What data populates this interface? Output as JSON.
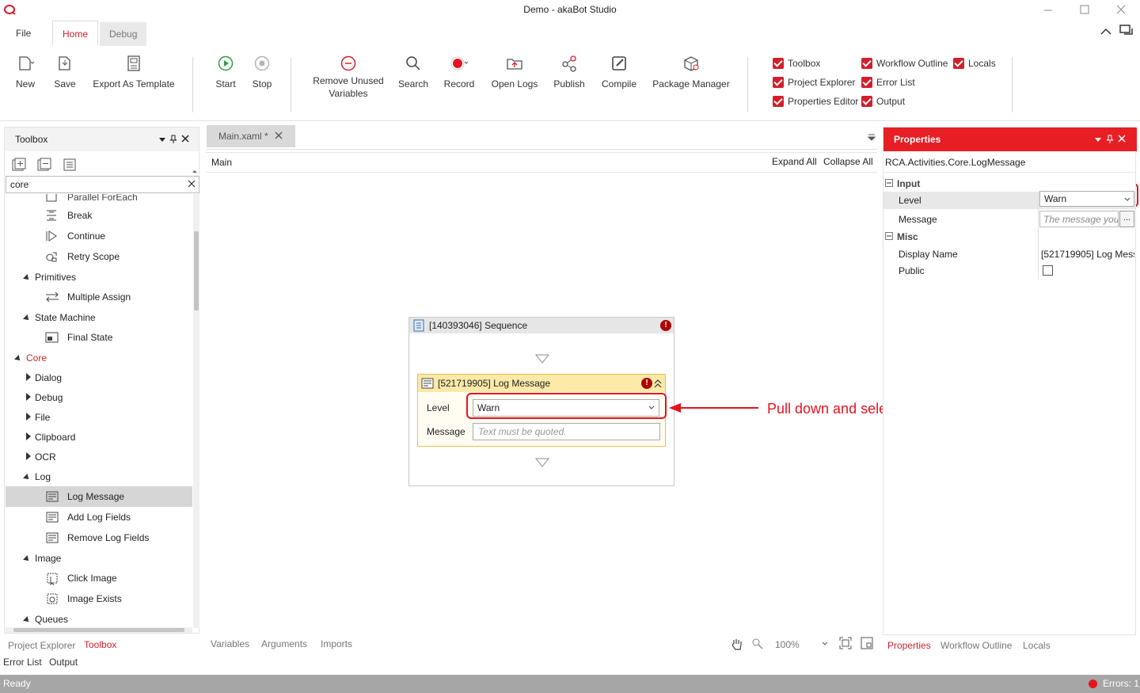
{
  "window": {
    "title": "Demo - akaBot Studio"
  },
  "ribbon_tabs": [
    "File",
    "Home",
    "Debug"
  ],
  "ribbon": {
    "new": "New",
    "save": "Save",
    "export_template": "Export As Template",
    "start": "Start",
    "stop": "Stop",
    "remove_unused_1": "Remove Unused",
    "remove_unused_2": "Variables",
    "search": "Search",
    "record": "Record",
    "open_logs": "Open Logs",
    "publish": "Publish",
    "compile": "Compile",
    "package_manager": "Package Manager"
  },
  "view_toggles": {
    "toolbox": "Toolbox",
    "project_explorer": "Project Explorer",
    "properties_editor": "Properties Editor",
    "workflow_outline": "Workflow Outline",
    "error_list": "Error List",
    "output": "Output",
    "locals": "Locals"
  },
  "toolbox": {
    "title": "Toolbox",
    "search_value": "core",
    "partial_item": "Parallel ForEach",
    "items": {
      "break": "Break",
      "continue": "Continue",
      "retry_scope": "Retry Scope",
      "primitives": "Primitives",
      "multiple_assign": "Multiple Assign",
      "state_machine": "State Machine",
      "final_state": "Final State",
      "core": "Core",
      "dialog": "Dialog",
      "debug": "Debug",
      "file": "File",
      "clipboard": "Clipboard",
      "ocr": "OCR",
      "log": "Log",
      "log_message": "Log Message",
      "add_log_fields": "Add Log Fields",
      "remove_log_fields": "Remove Log Fields",
      "image": "Image",
      "click_image": "Click Image",
      "image_exists": "Image Exists",
      "queues": "Queues"
    }
  },
  "document": {
    "tab": "Main.xaml *",
    "breadcrumb": "Main",
    "expand_all": "Expand All",
    "collapse_all": "Collapse All"
  },
  "sequence": {
    "title": "[140393046] Sequence",
    "activity": {
      "title": "[521719905] Log Message",
      "level_label": "Level",
      "level_value": "Warn",
      "message_label": "Message",
      "message_placeholder": "Text must be quoted."
    }
  },
  "annotation": {
    "text": "Pull down and select",
    "color": "#e3141e"
  },
  "properties": {
    "title": "Properties",
    "type": "RCA.Activities.Core.LogMessage",
    "input_section": "Input",
    "level_label": "Level",
    "level_value": "Warn",
    "message_label": "Message",
    "message_placeholder": "The message you",
    "misc_section": "Misc",
    "display_name_label": "Display Name",
    "display_name_value": "[521719905] Log Mess",
    "public_label": "Public",
    "ellipsis": "..."
  },
  "bottom_left_tabs": [
    "Project Explorer",
    "Toolbox",
    "Error List",
    "Output"
  ],
  "designer_footer": {
    "variables": "Variables",
    "arguments": "Arguments",
    "imports": "Imports",
    "zoom": "100%"
  },
  "bottom_right_tabs": [
    "Properties",
    "Workflow Outline",
    "Locals"
  ],
  "status": {
    "text": "Ready",
    "errors": "Errors: 1"
  },
  "colors": {
    "accent": "#d21f2b",
    "panel_header_red": "#e81e25"
  }
}
